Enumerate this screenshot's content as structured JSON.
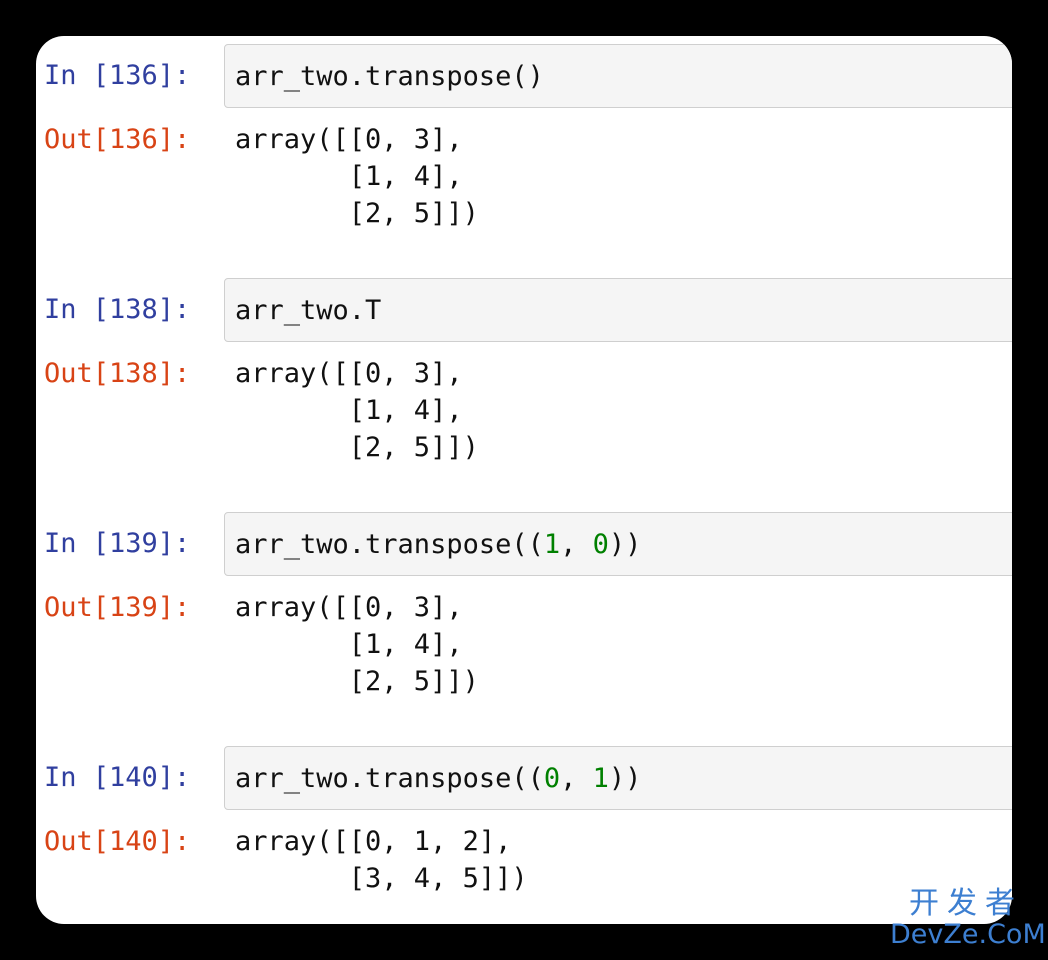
{
  "cells": [
    {
      "in_prompt": "In [136]:",
      "code": [
        "arr_two.transpose()"
      ],
      "out_prompt": "Out[136]:",
      "output": "array([[0, 3],\n       [1, 4],\n       [2, 5]])"
    },
    {
      "in_prompt": "In [138]:",
      "code": [
        "arr_two.T"
      ],
      "out_prompt": "Out[138]:",
      "output": "array([[0, 3],\n       [1, 4],\n       [2, 5]])"
    },
    {
      "in_prompt": "In [139]:",
      "code": [
        "arr_two.transpose((",
        "1",
        ", ",
        "0",
        "))"
      ],
      "out_prompt": "Out[139]:",
      "output": "array([[0, 3],\n       [1, 4],\n       [2, 5]])"
    },
    {
      "in_prompt": "In [140]:",
      "code": [
        "arr_two.transpose((",
        "0",
        ", ",
        "1",
        "))"
      ],
      "out_prompt": "Out[140]:",
      "output": "array([[0, 1, 2],\n       [3, 4, 5]])"
    }
  ],
  "watermark": {
    "line1": "开发者",
    "line2": "DevZe.CoM"
  },
  "colors": {
    "in_prompt": "#303f9f",
    "out_prompt": "#d84315",
    "number_literal": "#008000",
    "watermark": "#3d7fd1"
  }
}
